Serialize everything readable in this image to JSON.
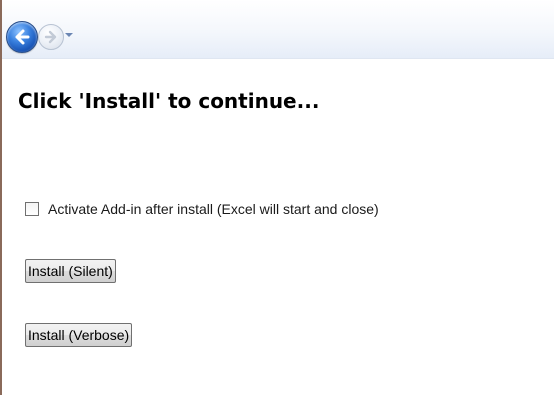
{
  "navigation": {
    "back_icon": "back-arrow-icon",
    "forward_icon": "forward-arrow-icon",
    "history_dropdown_icon": "chevron-down-icon"
  },
  "main": {
    "heading": "Click 'Install' to continue...",
    "activate_checkbox": {
      "label": "Activate Add-in after install (Excel will start and close)",
      "checked": false
    },
    "buttons": {
      "install_silent": "Install (Silent)",
      "install_verbose": "Install (Verbose)"
    }
  },
  "colors": {
    "back_button": "#3b82e0",
    "navbar_gradient_end": "#e6edf8"
  }
}
